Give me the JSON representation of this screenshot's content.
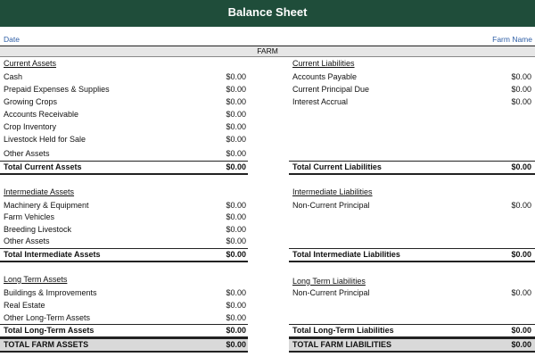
{
  "title": "Balance Sheet",
  "date_label": "Date",
  "farm_name_label": "Farm Name",
  "section_label": "FARM",
  "current_assets": {
    "header": "Current Assets",
    "items": [
      {
        "label": "Cash",
        "value": "$0.00"
      },
      {
        "label": "Prepaid Expenses & Supplies",
        "value": "$0.00"
      },
      {
        "label": "Growing Crops",
        "value": "$0.00"
      },
      {
        "label": "Accounts Receivable",
        "value": "$0.00"
      },
      {
        "label": "Crop Inventory",
        "value": "$0.00"
      },
      {
        "label": "Livestock Held for Sale",
        "value": "$0.00"
      },
      {
        "label": "Other Assets",
        "value": "$0.00"
      }
    ],
    "total_label": "Total Current Assets",
    "total_value": "$0.00"
  },
  "current_liabilities": {
    "header": "Current Liabilities",
    "items": [
      {
        "label": "Accounts Payable",
        "value": "$0.00"
      },
      {
        "label": "Current Principal Due",
        "value": "$0.00"
      },
      {
        "label": "Interest Accrual",
        "value": "$0.00"
      }
    ],
    "total_label": "Total Current Liabilities",
    "total_value": "$0.00"
  },
  "intermediate_assets": {
    "header": "Intermediate Assets",
    "items": [
      {
        "label": "Machinery & Equipment",
        "value": "$0.00"
      },
      {
        "label": "Farm Vehicles",
        "value": "$0.00"
      },
      {
        "label": "Breeding Livestock",
        "value": "$0.00"
      },
      {
        "label": "Other Assets",
        "value": "$0.00"
      }
    ],
    "total_label": "Total Intermediate Assets",
    "total_value": "$0.00"
  },
  "intermediate_liabilities": {
    "header": "Intermediate Liabilities",
    "items": [
      {
        "label": "Non-Current Principal",
        "value": "$0.00"
      }
    ],
    "total_label": "Total Intermediate Liabilities",
    "total_value": "$0.00"
  },
  "long_term_assets": {
    "header": "Long Term Assets",
    "items": [
      {
        "label": "Buildings & Improvements",
        "value": "$0.00"
      },
      {
        "label": "Real Estate",
        "value": "$0.00"
      },
      {
        "label": "Other Long-Term Assets",
        "value": "$0.00"
      }
    ],
    "total_label": "Total Long-Term Assets",
    "total_value": "$0.00"
  },
  "long_term_liabilities": {
    "header": "Long Term Liabilities",
    "items": [
      {
        "label": "Non-Current Principal",
        "value": "$0.00"
      }
    ],
    "total_label": "Total Long-Term Liabilities",
    "total_value": "$0.00"
  },
  "total_farm_assets": {
    "label": "TOTAL FARM ASSETS",
    "value": "$0.00"
  },
  "total_farm_liabilities": {
    "label": "TOTAL FARM LIABILITIES",
    "value": "$0.00"
  },
  "colors": {
    "title_bg": "#1f4d3a",
    "header_text": "#2f5fa6",
    "grand_total_bg": "#d9d9d9"
  }
}
